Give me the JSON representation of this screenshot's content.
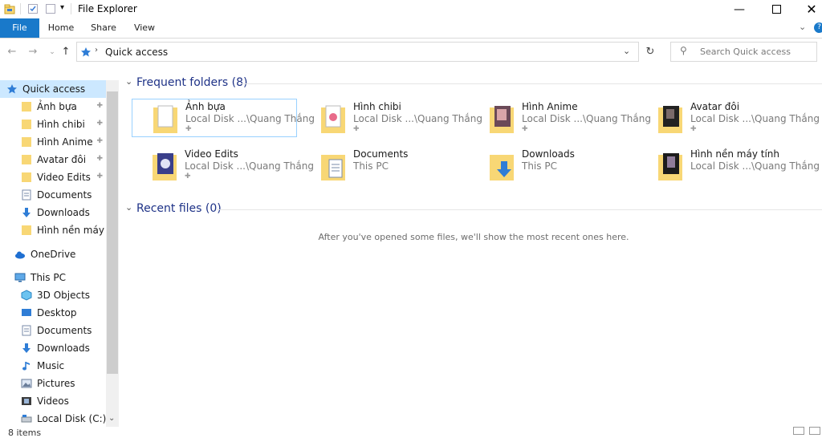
{
  "window": {
    "title": "File Explorer"
  },
  "ribbon": {
    "tabs": [
      "File",
      "Home",
      "Share",
      "View"
    ]
  },
  "address": {
    "location": "Quick access",
    "search_placeholder": "Search Quick access"
  },
  "nav": {
    "quick_access": "Quick access",
    "pinned": [
      "Ảnh bựa",
      "Hình chibi",
      "Hình Anime",
      "Avatar đôi",
      "Video Edits"
    ],
    "others": [
      "Documents",
      "Downloads",
      "Hình nền máy tín"
    ],
    "onedrive": "OneDrive",
    "this_pc": "This PC",
    "pc_items": [
      "3D Objects",
      "Desktop",
      "Documents",
      "Downloads",
      "Music",
      "Pictures",
      "Videos",
      "Local Disk (C:)"
    ]
  },
  "content": {
    "frequent_header": "Frequent folders (8)",
    "recent_header": "Recent files (0)",
    "recent_empty": "After you've opened some files, we'll show the most recent ones here.",
    "folders": [
      {
        "name": "Ảnh bựa",
        "sub": "Local Disk ...\\Quang Thắng",
        "pinned": true
      },
      {
        "name": "Hình chibi",
        "sub": "Local Disk ...\\Quang Thắng",
        "pinned": true
      },
      {
        "name": "Hình Anime",
        "sub": "Local Disk ...\\Quang Thắng",
        "pinned": true
      },
      {
        "name": "Avatar đôi",
        "sub": "Local Disk ...\\Quang Thắng",
        "pinned": true
      },
      {
        "name": "Video Edits",
        "sub": "Local Disk ...\\Quang Thắng",
        "pinned": true
      },
      {
        "name": "Documents",
        "sub": "This PC",
        "pinned": false
      },
      {
        "name": "Downloads",
        "sub": "This PC",
        "pinned": false
      },
      {
        "name": "Hình nền máy tính",
        "sub": "Local Disk ...\\Quang Thắng",
        "pinned": false
      }
    ]
  },
  "status": {
    "items": "8 items"
  },
  "colors": {
    "accent": "#1979ca",
    "folder": "#f8d775",
    "header": "#1e3287",
    "selection": "#cce8ff"
  }
}
